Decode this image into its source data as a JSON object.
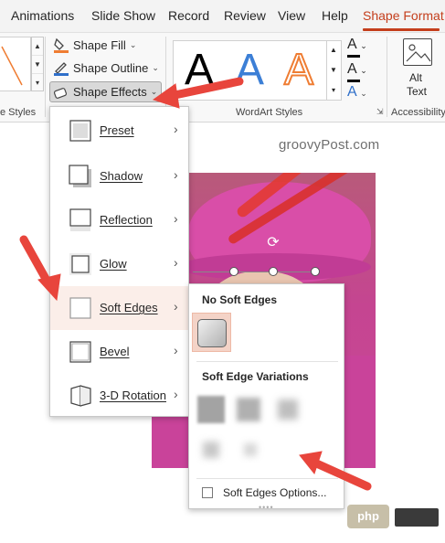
{
  "tabs": [
    "Animations",
    "Slide Show",
    "Record",
    "Review",
    "View",
    "Help",
    "Shape Format"
  ],
  "active_tab": "Shape Format",
  "ribbon": {
    "shape_styles_label": "Shape Styles",
    "shape_styles_visible": "e Styles",
    "shape_fill": "Shape Fill",
    "shape_outline": "Shape Outline",
    "shape_effects": "Shape Effects",
    "wordart_styles_label": "WordArt Styles",
    "wordart_letters": [
      "A",
      "A",
      "A"
    ],
    "wordart_colors": [
      "#000000",
      "#3c7fd6",
      "#ef7d33"
    ],
    "text_tools": [
      "A",
      "A",
      "A"
    ],
    "alt_text_line1": "Alt",
    "alt_text_line2": "Text",
    "accessibility_label": "Accessibility"
  },
  "watermark": "groovyPost.com",
  "shape_effects_menu": {
    "items": [
      {
        "label": "Preset",
        "icon": "preset-thumbnail"
      },
      {
        "label": "Shadow",
        "icon": "shadow-thumbnail"
      },
      {
        "label": "Reflection",
        "icon": "reflection-thumbnail"
      },
      {
        "label": "Glow",
        "icon": "glow-thumbnail"
      },
      {
        "label": "Soft Edges",
        "icon": "soft-edges-thumbnail"
      },
      {
        "label": "Bevel",
        "icon": "bevel-thumbnail"
      },
      {
        "label": "3-D Rotation",
        "icon": "3d-rotation-thumbnail"
      }
    ],
    "highlighted": "Soft Edges"
  },
  "soft_edges_submenu": {
    "no_soft_edges_heading": "No Soft Edges",
    "variations_heading": "Soft Edge Variations",
    "options_label": "Soft Edges Options...",
    "variation_count": 5
  },
  "badge": {
    "text": "php"
  },
  "colors": {
    "accent": "#c43e1c",
    "arrow": "#e8453c",
    "menu_highlight": "#fbeee9"
  }
}
